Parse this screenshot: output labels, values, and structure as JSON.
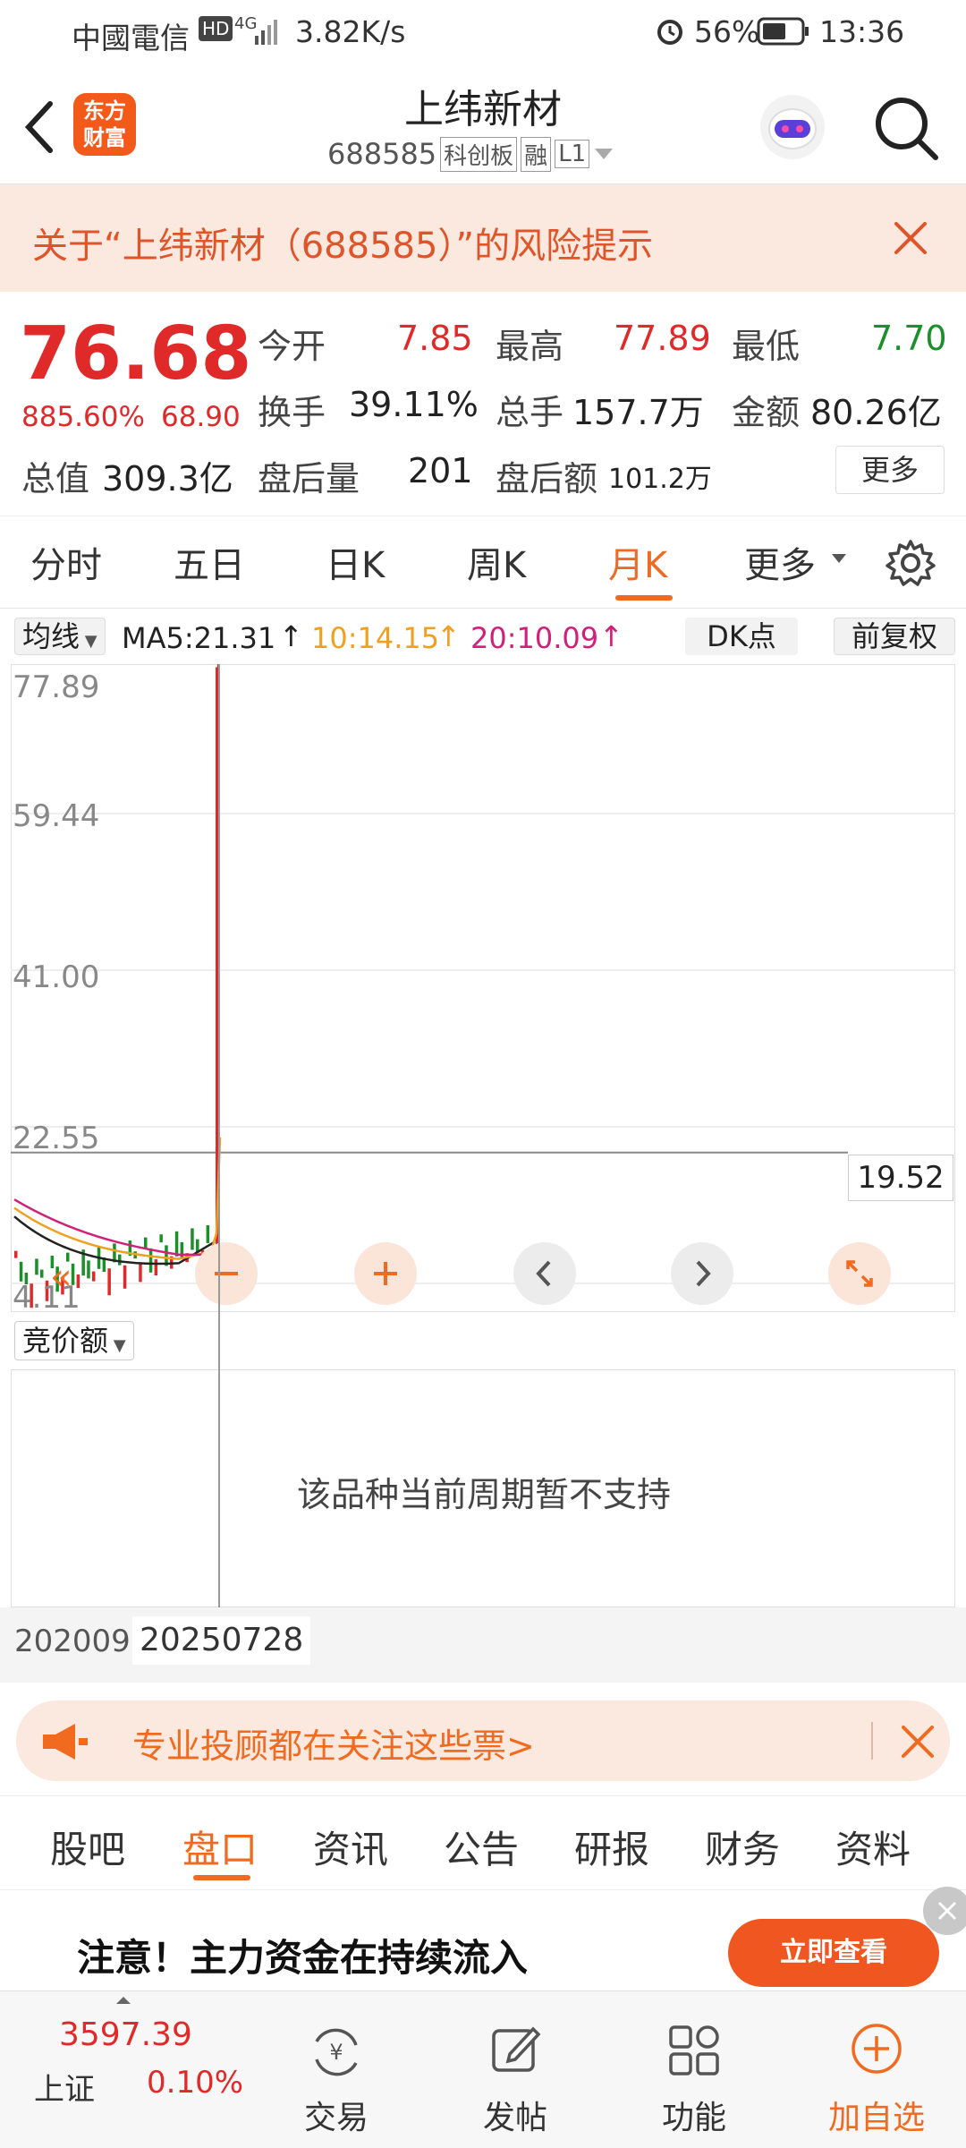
{
  "status_bar": {
    "carrier": "中國電信",
    "hd": "HD",
    "net": "4G",
    "speed": "3.82K/s",
    "battery": "56%",
    "time": "13:36"
  },
  "header": {
    "logo_line1": "东方",
    "logo_line2": "财富",
    "title": "上纬新材",
    "code": "688585",
    "tags": [
      "科创板",
      "融",
      "L1"
    ]
  },
  "risk_banner": {
    "text": "关于“上纬新材（688585）”的风险提示"
  },
  "quote": {
    "price": "76.68",
    "change_pct": "885.60%",
    "change": "68.90",
    "open_label": "今开",
    "open": "7.85",
    "high_label": "最高",
    "high": "77.89",
    "low_label": "最低",
    "low": "7.70",
    "turnover_label": "换手",
    "turnover": "39.11%",
    "volume_label": "总手",
    "volume": "157.7万",
    "amount_label": "金额",
    "amount": "80.26亿",
    "mktcap_label": "总值",
    "mktcap": "309.3亿",
    "after_vol_label": "盘后量",
    "after_vol": "201",
    "after_amt_label": "盘后额",
    "after_amt": "101.2万",
    "more_label": "更多"
  },
  "period_tabs": {
    "items": [
      "分时",
      "五日",
      "日K",
      "周K",
      "月K",
      "更多"
    ],
    "active": "月K"
  },
  "ma_row": {
    "indicator": "均线",
    "ma5": "MA5:21.31",
    "ma10": "10:14.15",
    "ma20": "20:10.09",
    "dk": "DK点",
    "adjust": "前复权"
  },
  "chart": {
    "y_labels": [
      "77.89",
      "59.44",
      "41.00",
      "22.55",
      "4.11"
    ],
    "crosshair_value": "19.52"
  },
  "chart_data": {
    "type": "line",
    "title": "",
    "x": [
      "202009",
      "20250728"
    ],
    "ylim": [
      4.11,
      77.89
    ],
    "y_ticks": [
      77.89,
      59.44,
      41.0,
      22.55,
      4.11
    ],
    "series": [
      {
        "name": "MA5",
        "values": [
          21.31
        ]
      },
      {
        "name": "MA10",
        "values": [
          14.15
        ]
      },
      {
        "name": "MA20",
        "values": [
          10.09
        ]
      }
    ],
    "crosshair_y": 19.52
  },
  "volume_panel": {
    "selector": "竞价额",
    "message": "该品种当前周期暂不支持"
  },
  "dates": {
    "start": "202009",
    "cursor": "20250728"
  },
  "ad1": {
    "text": "专业投顾都在关注这些票>"
  },
  "sub_tabs": {
    "items": [
      "股吧",
      "盘口",
      "资讯",
      "公告",
      "研报",
      "财务",
      "资料"
    ],
    "active": "盘口"
  },
  "ad2": {
    "text": "注意！主力资金在持续流入",
    "button": "立即查看"
  },
  "bottom_nav": {
    "index_value": "3597.39",
    "index_name": "上证",
    "index_change": "0.10%",
    "trade": "交易",
    "post": "发帖",
    "func": "功能",
    "add": "加自选"
  },
  "colors": {
    "up": "#e02a2a",
    "down": "#1a8f2a",
    "accent": "#f06a1f",
    "banner_bg": "#fbe8de"
  }
}
